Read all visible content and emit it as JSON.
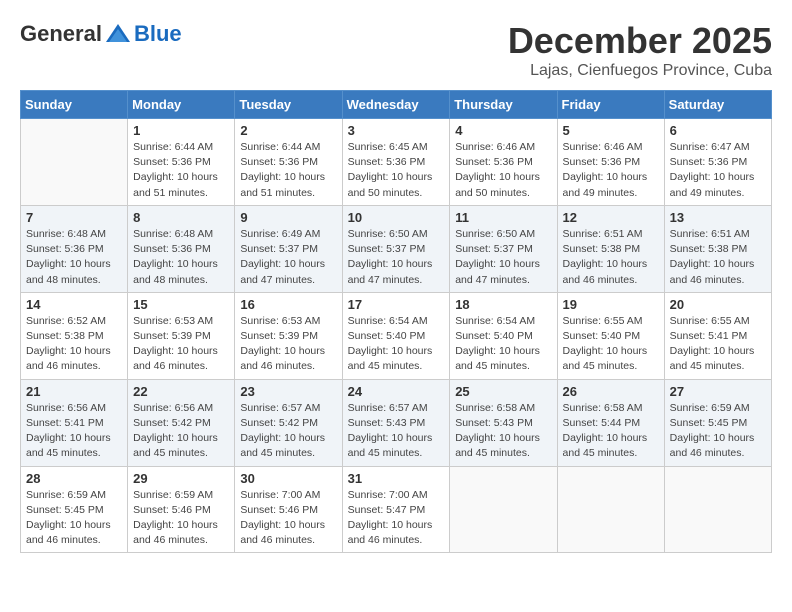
{
  "logo": {
    "general": "General",
    "blue": "Blue"
  },
  "title": "December 2025",
  "subtitle": "Lajas, Cienfuegos Province, Cuba",
  "days_of_week": [
    "Sunday",
    "Monday",
    "Tuesday",
    "Wednesday",
    "Thursday",
    "Friday",
    "Saturday"
  ],
  "weeks": [
    [
      {
        "day": "",
        "info": ""
      },
      {
        "day": "1",
        "info": "Sunrise: 6:44 AM\nSunset: 5:36 PM\nDaylight: 10 hours\nand 51 minutes."
      },
      {
        "day": "2",
        "info": "Sunrise: 6:44 AM\nSunset: 5:36 PM\nDaylight: 10 hours\nand 51 minutes."
      },
      {
        "day": "3",
        "info": "Sunrise: 6:45 AM\nSunset: 5:36 PM\nDaylight: 10 hours\nand 50 minutes."
      },
      {
        "day": "4",
        "info": "Sunrise: 6:46 AM\nSunset: 5:36 PM\nDaylight: 10 hours\nand 50 minutes."
      },
      {
        "day": "5",
        "info": "Sunrise: 6:46 AM\nSunset: 5:36 PM\nDaylight: 10 hours\nand 49 minutes."
      },
      {
        "day": "6",
        "info": "Sunrise: 6:47 AM\nSunset: 5:36 PM\nDaylight: 10 hours\nand 49 minutes."
      }
    ],
    [
      {
        "day": "7",
        "info": "Sunrise: 6:48 AM\nSunset: 5:36 PM\nDaylight: 10 hours\nand 48 minutes."
      },
      {
        "day": "8",
        "info": "Sunrise: 6:48 AM\nSunset: 5:36 PM\nDaylight: 10 hours\nand 48 minutes."
      },
      {
        "day": "9",
        "info": "Sunrise: 6:49 AM\nSunset: 5:37 PM\nDaylight: 10 hours\nand 47 minutes."
      },
      {
        "day": "10",
        "info": "Sunrise: 6:50 AM\nSunset: 5:37 PM\nDaylight: 10 hours\nand 47 minutes."
      },
      {
        "day": "11",
        "info": "Sunrise: 6:50 AM\nSunset: 5:37 PM\nDaylight: 10 hours\nand 47 minutes."
      },
      {
        "day": "12",
        "info": "Sunrise: 6:51 AM\nSunset: 5:38 PM\nDaylight: 10 hours\nand 46 minutes."
      },
      {
        "day": "13",
        "info": "Sunrise: 6:51 AM\nSunset: 5:38 PM\nDaylight: 10 hours\nand 46 minutes."
      }
    ],
    [
      {
        "day": "14",
        "info": "Sunrise: 6:52 AM\nSunset: 5:38 PM\nDaylight: 10 hours\nand 46 minutes."
      },
      {
        "day": "15",
        "info": "Sunrise: 6:53 AM\nSunset: 5:39 PM\nDaylight: 10 hours\nand 46 minutes."
      },
      {
        "day": "16",
        "info": "Sunrise: 6:53 AM\nSunset: 5:39 PM\nDaylight: 10 hours\nand 46 minutes."
      },
      {
        "day": "17",
        "info": "Sunrise: 6:54 AM\nSunset: 5:40 PM\nDaylight: 10 hours\nand 45 minutes."
      },
      {
        "day": "18",
        "info": "Sunrise: 6:54 AM\nSunset: 5:40 PM\nDaylight: 10 hours\nand 45 minutes."
      },
      {
        "day": "19",
        "info": "Sunrise: 6:55 AM\nSunset: 5:40 PM\nDaylight: 10 hours\nand 45 minutes."
      },
      {
        "day": "20",
        "info": "Sunrise: 6:55 AM\nSunset: 5:41 PM\nDaylight: 10 hours\nand 45 minutes."
      }
    ],
    [
      {
        "day": "21",
        "info": "Sunrise: 6:56 AM\nSunset: 5:41 PM\nDaylight: 10 hours\nand 45 minutes."
      },
      {
        "day": "22",
        "info": "Sunrise: 6:56 AM\nSunset: 5:42 PM\nDaylight: 10 hours\nand 45 minutes."
      },
      {
        "day": "23",
        "info": "Sunrise: 6:57 AM\nSunset: 5:42 PM\nDaylight: 10 hours\nand 45 minutes."
      },
      {
        "day": "24",
        "info": "Sunrise: 6:57 AM\nSunset: 5:43 PM\nDaylight: 10 hours\nand 45 minutes."
      },
      {
        "day": "25",
        "info": "Sunrise: 6:58 AM\nSunset: 5:43 PM\nDaylight: 10 hours\nand 45 minutes."
      },
      {
        "day": "26",
        "info": "Sunrise: 6:58 AM\nSunset: 5:44 PM\nDaylight: 10 hours\nand 45 minutes."
      },
      {
        "day": "27",
        "info": "Sunrise: 6:59 AM\nSunset: 5:45 PM\nDaylight: 10 hours\nand 46 minutes."
      }
    ],
    [
      {
        "day": "28",
        "info": "Sunrise: 6:59 AM\nSunset: 5:45 PM\nDaylight: 10 hours\nand 46 minutes."
      },
      {
        "day": "29",
        "info": "Sunrise: 6:59 AM\nSunset: 5:46 PM\nDaylight: 10 hours\nand 46 minutes."
      },
      {
        "day": "30",
        "info": "Sunrise: 7:00 AM\nSunset: 5:46 PM\nDaylight: 10 hours\nand 46 minutes."
      },
      {
        "day": "31",
        "info": "Sunrise: 7:00 AM\nSunset: 5:47 PM\nDaylight: 10 hours\nand 46 minutes."
      },
      {
        "day": "",
        "info": ""
      },
      {
        "day": "",
        "info": ""
      },
      {
        "day": "",
        "info": ""
      }
    ]
  ]
}
